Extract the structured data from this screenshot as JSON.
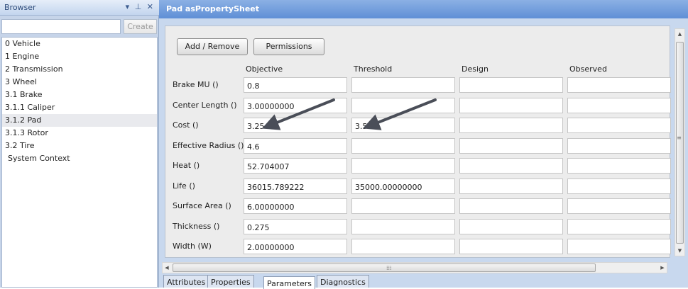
{
  "browser": {
    "title": "Browser",
    "controls": "▾ ⊥ ✕",
    "search": {
      "value": "",
      "placeholder": ""
    },
    "create_label": "Create",
    "tree": [
      {
        "label": "0 Vehicle",
        "selected": false
      },
      {
        "label": "1 Engine",
        "selected": false
      },
      {
        "label": "2 Transmission",
        "selected": false
      },
      {
        "label": "3 Wheel",
        "selected": false
      },
      {
        "label": "3.1 Brake",
        "selected": false
      },
      {
        "label": "3.1.1 Caliper",
        "selected": false
      },
      {
        "label": "3.1.2 Pad",
        "selected": true
      },
      {
        "label": "3.1.3 Rotor",
        "selected": false
      },
      {
        "label": "3.2 Tire",
        "selected": false
      },
      {
        "label": "System Context",
        "selected": false
      }
    ]
  },
  "sheet": {
    "title": "Pad asPropertySheet",
    "add_remove_label": "Add / Remove",
    "permissions_label": "Permissions",
    "columns": [
      "Objective",
      "Threshold",
      "Design",
      "Observed"
    ],
    "rows": [
      {
        "label": "Brake MU ()",
        "values": [
          "0.8",
          "",
          "",
          ""
        ]
      },
      {
        "label": "Center Length ()",
        "values": [
          "3.00000000",
          "",
          "",
          ""
        ]
      },
      {
        "label": "Cost ()",
        "values": [
          "3.25",
          "3.5",
          "",
          ""
        ]
      },
      {
        "label": "Effective Radius ()",
        "values": [
          "4.6",
          "",
          "",
          ""
        ]
      },
      {
        "label": "Heat ()",
        "values": [
          "52.704007",
          "",
          "",
          ""
        ]
      },
      {
        "label": "Life ()",
        "values": [
          "36015.789222",
          "35000.00000000",
          "",
          ""
        ]
      },
      {
        "label": "Surface Area ()",
        "values": [
          "6.00000000",
          "",
          "",
          ""
        ]
      },
      {
        "label": "Thickness ()",
        "values": [
          "0.275",
          "",
          "",
          ""
        ]
      },
      {
        "label": "Width (W)",
        "values": [
          "2.00000000",
          "",
          "",
          ""
        ]
      }
    ],
    "tabs": [
      {
        "label": "Attributes",
        "active": false
      },
      {
        "label": "Properties",
        "active": false
      },
      {
        "label": "Parameters",
        "active": true
      },
      {
        "label": "Diagnostics",
        "active": false
      }
    ],
    "scroll_glyph": "⁞⁞⁞"
  },
  "colors": {
    "title_bar": "#5f8fd6",
    "pane_background": "#c8d8ee",
    "annotation_arrow": "#4a4e58"
  }
}
